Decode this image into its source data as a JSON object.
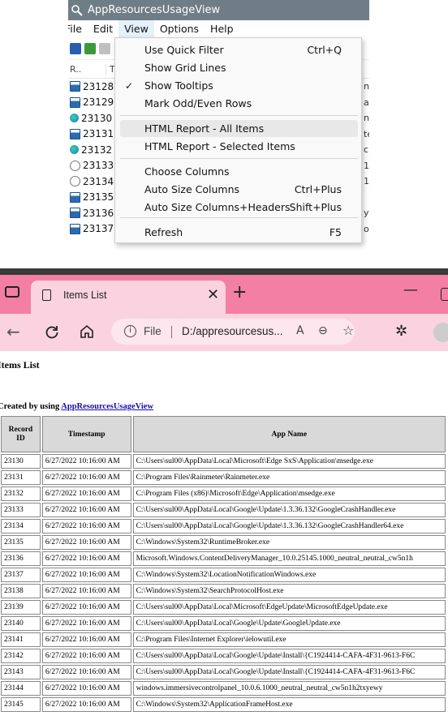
{
  "app": {
    "title": "AppResourcesUsageView",
    "menus": [
      "File",
      "Edit",
      "View",
      "Options",
      "Help"
    ],
    "column_headers": [
      "R..",
      "T"
    ],
    "rows": [
      {
        "id": "23128",
        "peek": "n",
        "icon": "exe"
      },
      {
        "id": "23129",
        "peek": "a",
        "icon": "exe"
      },
      {
        "id": "23130",
        "peek": "n",
        "icon": "edge"
      },
      {
        "id": "23131",
        "peek": "te",
        "icon": "exe"
      },
      {
        "id": "23132",
        "peek": "c",
        "icon": "edge"
      },
      {
        "id": "23133",
        "peek": "1",
        "icon": "google"
      },
      {
        "id": "23134",
        "peek": "1",
        "icon": "google"
      },
      {
        "id": "23135",
        "peek": "",
        "icon": "exe"
      },
      {
        "id": "23136",
        "peek": "y",
        "icon": "exe"
      },
      {
        "id": "23137",
        "peek": "ol",
        "icon": "exe"
      }
    ]
  },
  "view_menu": {
    "items": [
      {
        "label": "Use Quick Filter",
        "shortcut": "Ctrl+Q",
        "checked": false
      },
      {
        "label": "Show Grid Lines",
        "shortcut": "",
        "checked": false
      },
      {
        "label": "Show Tooltips",
        "shortcut": "",
        "checked": true
      },
      {
        "label": "Mark Odd/Even Rows",
        "shortcut": "",
        "checked": false
      },
      {
        "label": "HTML Report - All Items",
        "shortcut": "",
        "checked": false,
        "highlighted": true
      },
      {
        "label": "HTML Report - Selected Items",
        "shortcut": "",
        "checked": false
      },
      {
        "label": "Choose Columns",
        "shortcut": "",
        "checked": false
      },
      {
        "label": "Auto Size Columns",
        "shortcut": "Ctrl+Plus",
        "checked": false
      },
      {
        "label": "Auto Size Columns+Headers",
        "shortcut": "Shift+Plus",
        "checked": false
      },
      {
        "label": "Refresh",
        "shortcut": "F5",
        "checked": false
      }
    ],
    "check_glyph": "✓"
  },
  "browser": {
    "tab_title": "Items List",
    "tab_close": "✕",
    "new_tab": "+",
    "minimize": "—",
    "address_label": "File",
    "address_url": "D:/appresourcesus...",
    "accent_color": "#f37fa4"
  },
  "report": {
    "title": "Items List",
    "created_prefix": "Created by using ",
    "created_link": "AppResourcesUsageView",
    "headers": [
      "Record ID",
      "Timestamp",
      "App Name"
    ],
    "rows": [
      [
        "23130",
        "6/27/2022 10:16:00 AM",
        "C:\\Users\\sul00\\AppData\\Local\\Microsoft\\Edge SxS\\Application\\msedge.exe"
      ],
      [
        "23131",
        "6/27/2022 10:16:00 AM",
        "C:\\Program Files\\Rainmeter\\Rainmeter.exe"
      ],
      [
        "23132",
        "6/27/2022 10:16:00 AM",
        "C:\\Program Files (x86)\\Microsoft\\Edge\\Application\\msedge.exe"
      ],
      [
        "23133",
        "6/27/2022 10:16:00 AM",
        "C:\\Users\\sul00\\AppData\\Local\\Google\\Update\\1.3.36.132\\GoogleCrashHandler.exe"
      ],
      [
        "23134",
        "6/27/2022 10:16:00 AM",
        "C:\\Users\\sul00\\AppData\\Local\\Google\\Update\\1.3.36.132\\GoogleCrashHandler64.exe"
      ],
      [
        "23135",
        "6/27/2022 10:16:00 AM",
        "C:\\Windows\\System32\\RuntimeBroker.exe"
      ],
      [
        "23136",
        "6/27/2022 10:16:00 AM",
        "Microsoft.Windows.ContentDeliveryManager_10.0.25145.1000_neutral_neutral_cw5n1h"
      ],
      [
        "23137",
        "6/27/2022 10:16:00 AM",
        "C:\\Windows\\System32\\LocationNotificationWindows.exe"
      ],
      [
        "23138",
        "6/27/2022 10:16:00 AM",
        "C:\\Windows\\System32\\SearchProtocolHost.exe"
      ],
      [
        "23139",
        "6/27/2022 10:16:00 AM",
        "C:\\Users\\sul00\\AppData\\Local\\Microsoft\\EdgeUpdate\\MicrosoftEdgeUpdate.exe"
      ],
      [
        "23140",
        "6/27/2022 10:16:00 AM",
        "C:\\Users\\sul00\\AppData\\Local\\Google\\Update\\GoogleUpdate.exe"
      ],
      [
        "23141",
        "6/27/2022 10:16:00 AM",
        "C:\\Program Files\\Internet Explorer\\ielowutil.exe"
      ],
      [
        "23142",
        "6/27/2022 10:16:00 AM",
        "C:\\Users\\sul00\\AppData\\Local\\Google\\Update\\Install\\{C1924414-CAFA-4F31-9613-F6C"
      ],
      [
        "23143",
        "6/27/2022 10:16:00 AM",
        "C:\\Users\\sul00\\AppData\\Local\\Google\\Update\\Install\\{C1924414-CAFA-4F31-9613-F6C"
      ],
      [
        "23144",
        "6/27/2022 10:16:00 AM",
        "windows.immersivecontrolpanel_10.0.6.1000_neutral_neutral_cw5n1h2txyewy"
      ],
      [
        "23145",
        "6/27/2022 10:16:00 AM",
        "C:\\Windows\\System32\\ApplicationFrameHost.exe"
      ]
    ]
  }
}
